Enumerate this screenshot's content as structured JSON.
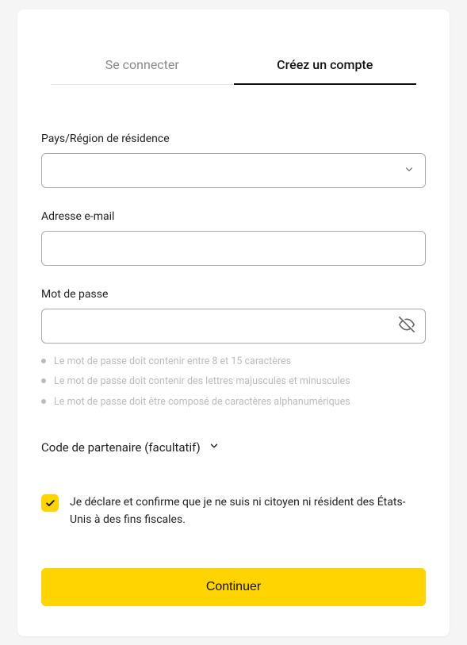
{
  "tabs": {
    "login": "Se connecter",
    "signup": "Créez un compte"
  },
  "form": {
    "country_label": "Pays/Région de résidence",
    "country_value": "",
    "email_label": "Adresse e-mail",
    "email_value": "",
    "password_label": "Mot de passe",
    "password_value": "",
    "hints": [
      "Le mot de passe doit contenir entre 8 et 15 caractères",
      "Le mot de passe doit contenir des lettres majuscules et minuscules",
      "Le mot de passe doit être composé de caractères alphanumériques"
    ],
    "partner_code_label": "Code de partenaire (facultatif)",
    "declaration": "Je déclare et confirme que je ne suis ni citoyen ni résident des États-Unis à des fins fiscales.",
    "submit_label": "Continuer"
  }
}
